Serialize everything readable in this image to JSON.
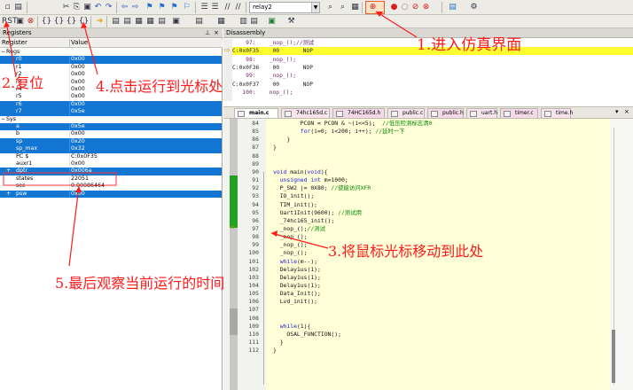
{
  "toolbar": {
    "target_name": "relay2"
  },
  "registers": {
    "title": "Registers",
    "col_register": "Register",
    "col_value": "Value",
    "group_regs": "Regs",
    "group_sys": "Sys",
    "regs": [
      {
        "name": "r0",
        "value": "0x00"
      },
      {
        "name": "r1",
        "value": "0x00"
      },
      {
        "name": "r2",
        "value": "0x00"
      },
      {
        "name": "r3",
        "value": "0x00"
      },
      {
        "name": "r4",
        "value": "0x00"
      },
      {
        "name": "r5",
        "value": "0x00"
      },
      {
        "name": "r6",
        "value": "0x00"
      },
      {
        "name": "r7",
        "value": "0x5e"
      }
    ],
    "sys": [
      {
        "name": "a",
        "value": "0x5e"
      },
      {
        "name": "b",
        "value": "0x00"
      },
      {
        "name": "sp",
        "value": "0x20"
      },
      {
        "name": "sp_max",
        "value": "0x32"
      },
      {
        "name": "PC  $",
        "value": "C:0x0F35"
      },
      {
        "name": "auxr1",
        "value": "0x00"
      },
      {
        "name": "dptr",
        "value": "0x006a"
      },
      {
        "name": "states",
        "value": "22051"
      },
      {
        "name": "sec",
        "value": "0.00086464"
      },
      {
        "name": "psw",
        "value": "0x00"
      }
    ]
  },
  "disassembly": {
    "title": "Disassembly",
    "lines": [
      {
        "text": "    97:    _nop_();//测试",
        "kind": "src"
      },
      {
        "text": "C:0x0F35    00       NOP",
        "kind": "hl"
      },
      {
        "text": "    98:    _nop_();",
        "kind": "src"
      },
      {
        "text": "C:0x0F36    00       NOP",
        "kind": "asm"
      },
      {
        "text": "    99:    _nop_();",
        "kind": "src"
      },
      {
        "text": "C:0x0F37    00       NOP",
        "kind": "asm"
      },
      {
        "text": "   100:    nop_();",
        "kind": "src"
      }
    ]
  },
  "tabs": [
    {
      "label": "main.c",
      "active": true
    },
    {
      "label": "74hc165d.c",
      "active": false
    },
    {
      "label": "74HC165d.h",
      "active": false
    },
    {
      "label": "public.c",
      "active": false
    },
    {
      "label": "public.h",
      "active": false
    },
    {
      "label": "uart.h",
      "active": false
    },
    {
      "label": "timer.c",
      "active": false
    },
    {
      "label": "time.h",
      "active": false
    }
  ],
  "code": [
    {
      "ln": "84",
      "text": "        PCON = PCON & ~(i<<5);  //低压检测标志清0"
    },
    {
      "ln": "85",
      "text": "        for(i=0; i<200; i++); //延时一下"
    },
    {
      "ln": "86",
      "text": "    }"
    },
    {
      "ln": "87",
      "text": "}"
    },
    {
      "ln": "88",
      "text": ""
    },
    {
      "ln": "89",
      "text": ""
    },
    {
      "ln": "90",
      "text": "void main(void){"
    },
    {
      "ln": "91",
      "text": "  unsigned int m=1000;"
    },
    {
      "ln": "92",
      "text": "  P_SW2 |= 0X80; //使能访问XFR"
    },
    {
      "ln": "93",
      "text": "  IO_init();"
    },
    {
      "ln": "94",
      "text": "  TIM_init();"
    },
    {
      "ln": "95",
      "text": "  Uart1Init(9600); //测试用"
    },
    {
      "ln": "96",
      "text": "  _74hc165_init();"
    },
    {
      "ln": "97",
      "text": "  _nop_();//测试"
    },
    {
      "ln": "98",
      "text": "  _nop_();"
    },
    {
      "ln": "99",
      "text": "  _nop_();"
    },
    {
      "ln": "100",
      "text": "  _nop_();"
    },
    {
      "ln": "101",
      "text": "  while(m--);"
    },
    {
      "ln": "102",
      "text": "  Delay1us(1);"
    },
    {
      "ln": "103",
      "text": "  Delay1us(1);"
    },
    {
      "ln": "104",
      "text": "  Delay1us(1);"
    },
    {
      "ln": "105",
      "text": "  Data_Init();"
    },
    {
      "ln": "106",
      "text": "  Lvd_init();"
    },
    {
      "ln": "107",
      "text": ""
    },
    {
      "ln": "108",
      "text": ""
    },
    {
      "ln": "109",
      "text": "  while(1){"
    },
    {
      "ln": "110",
      "text": "    OSAL_FUNCTION();"
    },
    {
      "ln": "111",
      "text": "  }"
    },
    {
      "ln": "112",
      "text": "}"
    }
  ],
  "annotations": {
    "a1": "1.进入仿真界面",
    "a2": "2.复位",
    "a3": "3.将鼠标光标移动到此处",
    "a4": "4.点击运行到光标处",
    "a5": "5.最后观察当前运行的时间"
  },
  "colors": {
    "selection": "#1476d3",
    "highlight": "#ffff30",
    "annotation": "#ff1a1a",
    "editor_bg": "#ffffd8"
  }
}
